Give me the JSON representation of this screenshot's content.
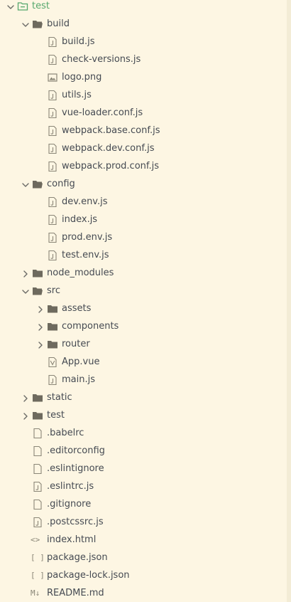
{
  "explorer": {
    "items": [
      {
        "label": "test",
        "kind": "root",
        "depth": 0,
        "expanded": true
      },
      {
        "label": "build",
        "kind": "folder",
        "depth": 1,
        "expanded": true
      },
      {
        "label": "build.js",
        "kind": "file-js",
        "depth": 2
      },
      {
        "label": "check-versions.js",
        "kind": "file-js",
        "depth": 2
      },
      {
        "label": "logo.png",
        "kind": "file-image",
        "depth": 2
      },
      {
        "label": "utils.js",
        "kind": "file-js",
        "depth": 2
      },
      {
        "label": "vue-loader.conf.js",
        "kind": "file-js",
        "depth": 2
      },
      {
        "label": "webpack.base.conf.js",
        "kind": "file-js",
        "depth": 2
      },
      {
        "label": "webpack.dev.conf.js",
        "kind": "file-js",
        "depth": 2
      },
      {
        "label": "webpack.prod.conf.js",
        "kind": "file-js",
        "depth": 2
      },
      {
        "label": "config",
        "kind": "folder",
        "depth": 1,
        "expanded": true
      },
      {
        "label": "dev.env.js",
        "kind": "file-js",
        "depth": 2
      },
      {
        "label": "index.js",
        "kind": "file-js",
        "depth": 2
      },
      {
        "label": "prod.env.js",
        "kind": "file-js",
        "depth": 2
      },
      {
        "label": "test.env.js",
        "kind": "file-js",
        "depth": 2
      },
      {
        "label": "node_modules",
        "kind": "folder",
        "depth": 1,
        "expanded": false
      },
      {
        "label": "src",
        "kind": "folder",
        "depth": 1,
        "expanded": true
      },
      {
        "label": "assets",
        "kind": "folder",
        "depth": 2,
        "expanded": false
      },
      {
        "label": "components",
        "kind": "folder",
        "depth": 2,
        "expanded": false
      },
      {
        "label": "router",
        "kind": "folder",
        "depth": 2,
        "expanded": false
      },
      {
        "label": "App.vue",
        "kind": "file-vue",
        "depth": 2
      },
      {
        "label": "main.js",
        "kind": "file-js",
        "depth": 2
      },
      {
        "label": "static",
        "kind": "folder",
        "depth": 1,
        "expanded": false
      },
      {
        "label": "test",
        "kind": "folder",
        "depth": 1,
        "expanded": false
      },
      {
        "label": ".babelrc",
        "kind": "file-plain",
        "depth": 1
      },
      {
        "label": ".editorconfig",
        "kind": "file-plain",
        "depth": 1
      },
      {
        "label": ".eslintignore",
        "kind": "file-plain",
        "depth": 1
      },
      {
        "label": ".eslintrc.js",
        "kind": "file-js",
        "depth": 1
      },
      {
        "label": ".gitignore",
        "kind": "file-plain",
        "depth": 1
      },
      {
        "label": ".postcssrc.js",
        "kind": "file-js",
        "depth": 1
      },
      {
        "label": "index.html",
        "kind": "file-html",
        "depth": 1,
        "glyph": "<>"
      },
      {
        "label": "package.json",
        "kind": "file-json",
        "depth": 1,
        "glyph": "[ ]"
      },
      {
        "label": "package-lock.json",
        "kind": "file-json",
        "depth": 1,
        "glyph": "[ ]"
      },
      {
        "label": "README.md",
        "kind": "file-md",
        "depth": 1,
        "glyph": "M↓"
      }
    ]
  },
  "colors": {
    "background": "#fdf6e3",
    "root_label": "#55a86d",
    "text": "#454a52",
    "icon": "#8a8677"
  }
}
